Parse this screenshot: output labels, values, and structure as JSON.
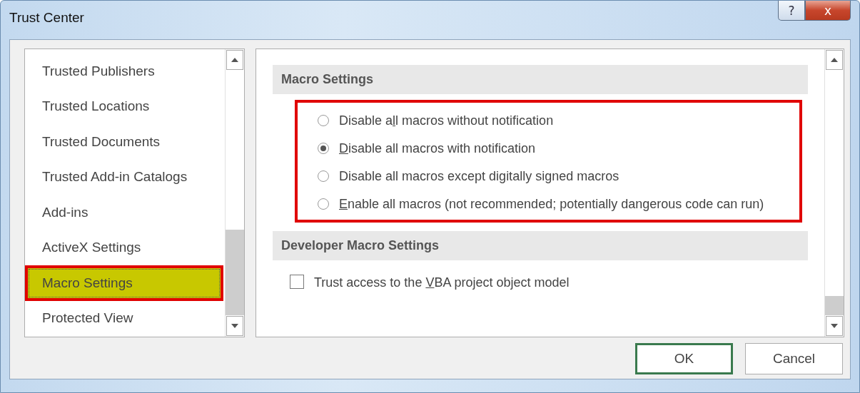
{
  "window": {
    "title": "Trust Center"
  },
  "title_buttons": [
    {
      "kind": "help",
      "label": "?"
    },
    {
      "kind": "close",
      "label": "x"
    }
  ],
  "sidebar": {
    "items": [
      {
        "label": "Trusted Publishers",
        "selected": false,
        "annotated": false
      },
      {
        "label": "Trusted Locations",
        "selected": false,
        "annotated": false
      },
      {
        "label": "Trusted Documents",
        "selected": false,
        "annotated": false
      },
      {
        "label": "Trusted Add-in Catalogs",
        "selected": false,
        "annotated": false
      },
      {
        "label": "Add-ins",
        "selected": false,
        "annotated": false
      },
      {
        "label": "ActiveX Settings",
        "selected": false,
        "annotated": false
      },
      {
        "label": "Macro Settings",
        "selected": true,
        "annotated": true
      },
      {
        "label": "Protected View",
        "selected": false,
        "annotated": false
      }
    ]
  },
  "sections": [
    {
      "heading": "Macro Settings",
      "annotated": true,
      "options": [
        {
          "kind": "radio",
          "before": "Disable a",
          "key": "l",
          "after": "l macros without notification",
          "selected": false
        },
        {
          "kind": "radio",
          "key": "D",
          "after": "isable all macros with notification",
          "selected": true
        },
        {
          "kind": "radio",
          "before": "Disable all macros except di",
          "key": "g",
          "after": "itally signed macros",
          "selected": false
        },
        {
          "kind": "radio",
          "key": "E",
          "after": "nable all macros (not recommended; potentially dangerous code can run)",
          "selected": false
        }
      ]
    },
    {
      "heading": "Developer Macro Settings",
      "annotated": false,
      "options": [
        {
          "kind": "checkbox",
          "before": "Trust access to the ",
          "key": "V",
          "after": "BA project object model",
          "checked": false
        }
      ]
    }
  ],
  "buttons": [
    {
      "label": "OK",
      "default": true
    },
    {
      "label": "Cancel",
      "default": false
    }
  ]
}
